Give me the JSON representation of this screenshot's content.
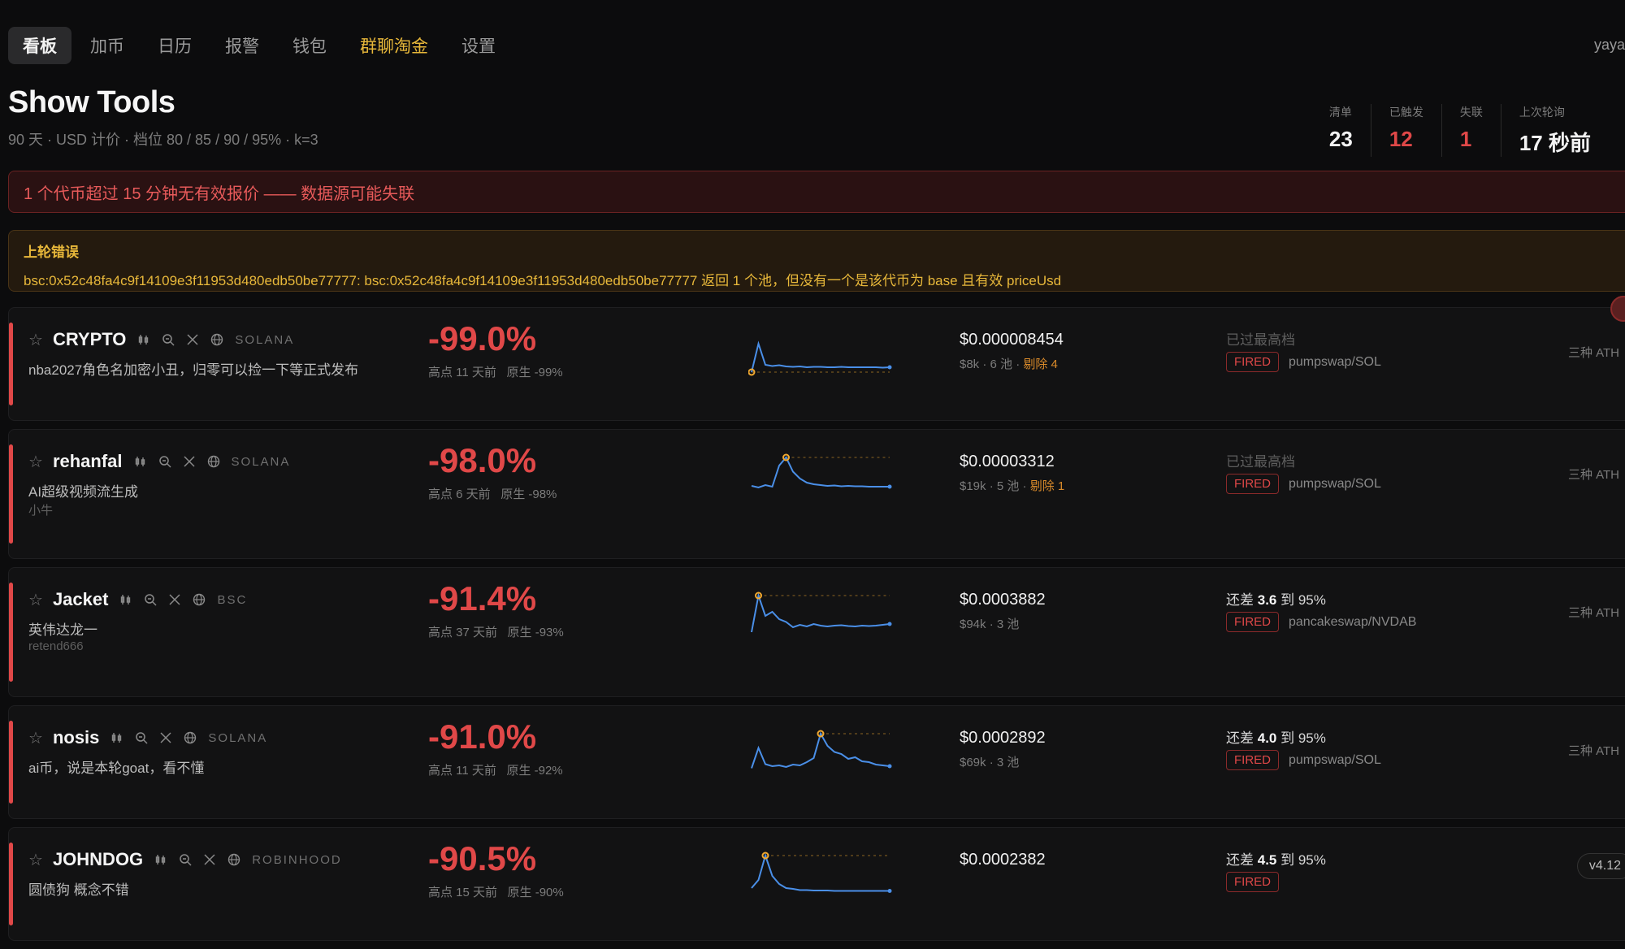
{
  "nav": {
    "tabs": [
      {
        "label": "看板"
      },
      {
        "label": "加币"
      },
      {
        "label": "日历"
      },
      {
        "label": "报警"
      },
      {
        "label": "钱包"
      },
      {
        "label": "群聊淘金"
      },
      {
        "label": "设置"
      }
    ],
    "active_index": 0,
    "user": "yaya"
  },
  "header": {
    "title": "Show Tools",
    "subtitle": "90 天 · USD 计价 · 档位 80 / 85 / 90 / 95% · k=3"
  },
  "stats": [
    {
      "label": "清单",
      "value": "23"
    },
    {
      "label": "已触发",
      "value": "12"
    },
    {
      "label": "失联",
      "value": "1"
    },
    {
      "label": "上次轮询",
      "value": "17 秒前"
    }
  ],
  "alert_stale": "1 个代币超过 15 分钟无有效报价 —— 数据源可能失联",
  "alert_error": {
    "title": "上轮错误",
    "body": "bsc:0x52c48fa4c9f14109e3f11953d480edb50be77777: bsc:0x52c48fa4c9f14109e3f11953d480edb50be77777 返回 1 个池，但没有一个是该代币为 base 且有效 priceUsd"
  },
  "tokens": [
    {
      "symbol": "CRYPTO",
      "chain": "SOLANA",
      "desc": "nba2027角色名加密小丑，归零可以捡一下等正式发布",
      "desc2": "",
      "pct": "-99.0%",
      "peak": "高点 11 天前",
      "orig": "原生 -99%",
      "price": "$0.000008454",
      "meta": "$8k · 6 池 · ",
      "meta_warn": "剔除 4",
      "status_prefix": "已过最高档",
      "status_value": "",
      "status_suffix": "",
      "badge": "FIRED",
      "pool": "pumpswap/SOL",
      "ath": "三种 ATH",
      "spark": [
        100,
        30,
        82,
        85,
        83,
        86,
        87,
        86,
        88,
        87,
        87,
        88,
        88,
        87,
        88,
        88,
        88,
        88,
        88,
        89,
        88
      ],
      "spark_peak": 0
    },
    {
      "symbol": "rehanfal",
      "chain": "SOLANA",
      "desc": "AI超级视频流生成",
      "desc2": "小牛",
      "pct": "-98.0%",
      "peak": "高点 6 天前",
      "orig": "原生 -98%",
      "price": "$0.00003312",
      "meta": "$19k · 5 池 · ",
      "meta_warn": "剔除 1",
      "status_prefix": "已过最高档",
      "status_value": "",
      "status_suffix": "",
      "badge": "FIRED",
      "pool": "pumpswap/SOL",
      "ath": "三种 ATH",
      "spark": [
        80,
        84,
        78,
        82,
        30,
        10,
        45,
        62,
        72,
        76,
        78,
        80,
        79,
        81,
        80,
        81,
        81,
        82,
        82,
        82,
        82
      ],
      "spark_peak": 5
    },
    {
      "symbol": "Jacket",
      "chain": "BSC",
      "desc": "英伟达龙一",
      "desc2": "retend666",
      "pct": "-91.4%",
      "peak": "高点 37 天前",
      "orig": "原生 -93%",
      "price": "$0.0003882",
      "meta": "$94k · 3 池",
      "meta_warn": "",
      "status_prefix": "还差 ",
      "status_value": "3.6",
      "status_suffix": " 到 95%",
      "badge": "FIRED",
      "pool": "pancakeswap/NVDAB",
      "ath": "三种 ATH",
      "spark": [
        100,
        10,
        60,
        50,
        68,
        75,
        88,
        82,
        86,
        80,
        84,
        86,
        84,
        83,
        85,
        86,
        84,
        85,
        84,
        82,
        80
      ],
      "spark_peak": 1
    },
    {
      "symbol": "nosis",
      "chain": "SOLANA",
      "desc": "ai币，说是本轮goat，看不懂",
      "desc2": "",
      "pct": "-91.0%",
      "peak": "高点 11 天前",
      "orig": "原生 -92%",
      "price": "$0.0002892",
      "meta": "$69k · 3 池",
      "meta_warn": "",
      "status_prefix": "还差 ",
      "status_value": "4.0",
      "status_suffix": " 到 95%",
      "badge": "FIRED",
      "pool": "pumpswap/SOL",
      "ath": "三种 ATH",
      "spark": [
        95,
        45,
        85,
        90,
        88,
        92,
        86,
        88,
        80,
        70,
        10,
        40,
        55,
        60,
        72,
        68,
        78,
        80,
        86,
        88,
        90
      ],
      "spark_peak": 10
    },
    {
      "symbol": "JOHNDOG",
      "chain": "ROBINHOOD",
      "desc": "圆债狗 概念不错",
      "desc2": "",
      "pct": "-90.5%",
      "peak": "高点 15 天前",
      "orig": "原生 -90%",
      "price": "$0.0002382",
      "meta": "",
      "meta_warn": "",
      "status_prefix": "还差 ",
      "status_value": "4.5",
      "status_suffix": " 到 95%",
      "badge": "FIRED",
      "pool": "",
      "ath": "",
      "spark": [
        90,
        70,
        10,
        60,
        80,
        90,
        92,
        95,
        95,
        96,
        96,
        96,
        97,
        97,
        97,
        97,
        97,
        97,
        97,
        97,
        97
      ],
      "spark_peak": 2
    }
  ],
  "version": "v4.12",
  "colors": {
    "accent_red": "#e04848",
    "gold": "#e8b83a",
    "spark_line": "#4a8fe8",
    "peak_dot": "#f0a830"
  }
}
